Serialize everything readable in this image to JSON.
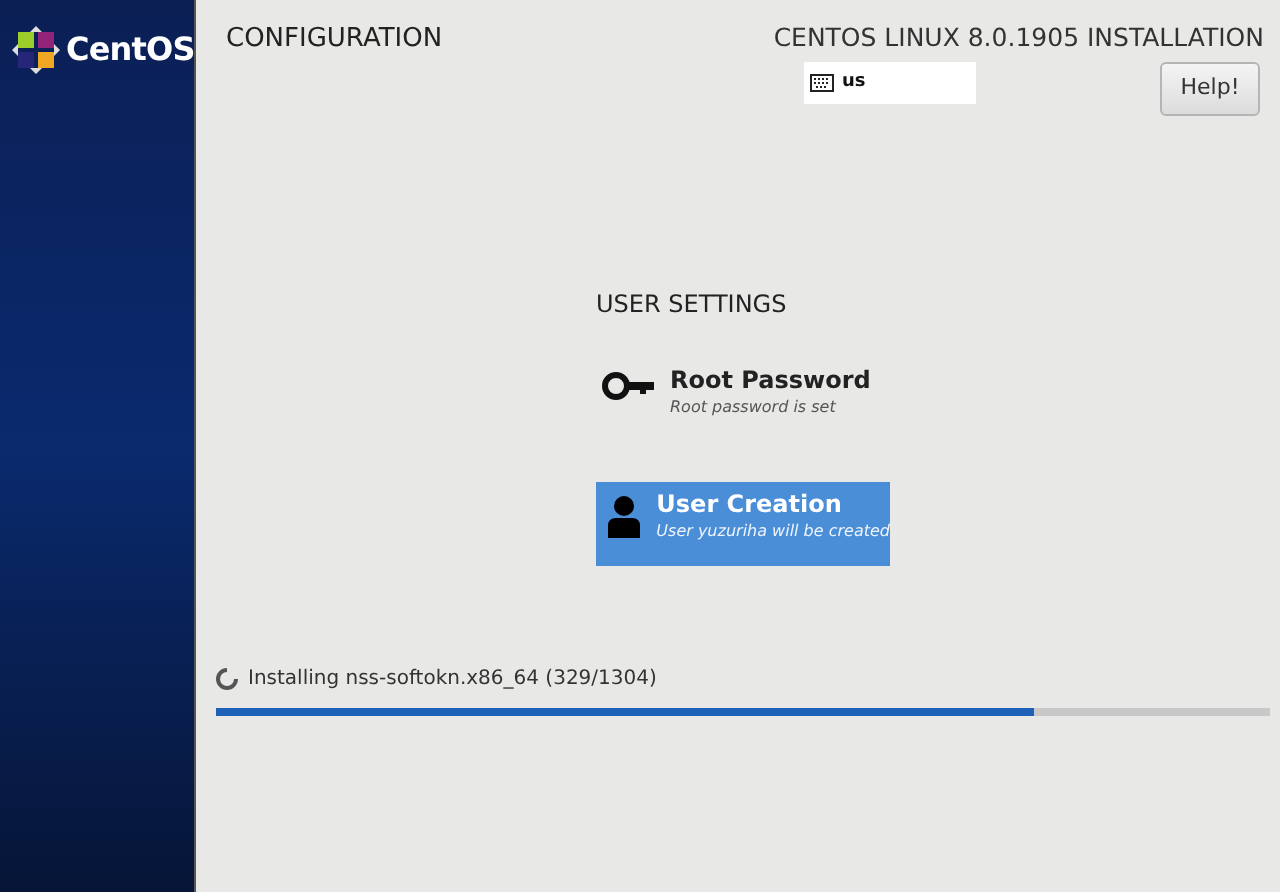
{
  "sidebar": {
    "logo_text": "CentOS"
  },
  "header": {
    "title": "CONFIGURATION",
    "product": "CENTOS LINUX 8.0.1905 INSTALLATION",
    "keyboard_layout": "us",
    "help_button": "Help!"
  },
  "section": {
    "title": "USER SETTINGS",
    "spokes": [
      {
        "kind": "key",
        "title": "Root Password",
        "status": "Root password is set",
        "selected": false
      },
      {
        "kind": "user",
        "title": "User Creation",
        "status": "User yuzuriha will be created",
        "selected": true
      }
    ]
  },
  "progress": {
    "text": "Installing nss-softokn.x86_64 (329/1304)",
    "level": 0.776
  }
}
